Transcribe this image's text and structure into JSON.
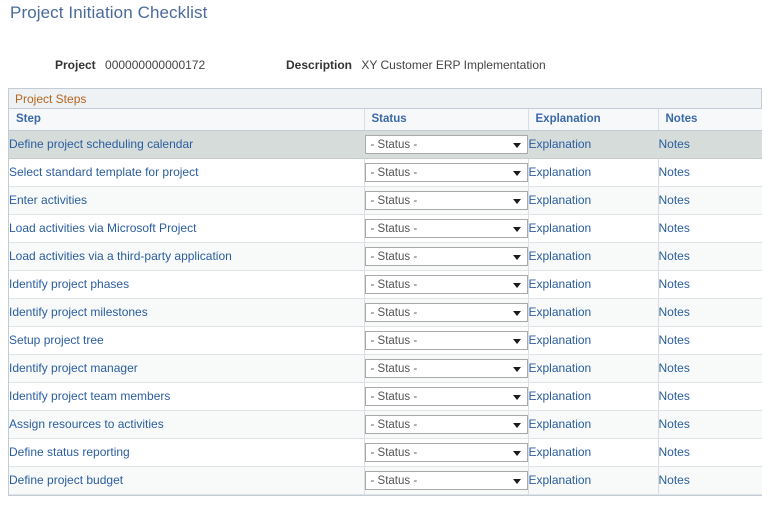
{
  "page": {
    "title": "Project Initiation Checklist"
  },
  "header_fields": {
    "project_label": "Project",
    "project_value": "000000000000172",
    "description_label": "Description",
    "description_value": "XY Customer ERP Implementation"
  },
  "group": {
    "title": "Project Steps"
  },
  "grid": {
    "columns": {
      "step": "Step",
      "status": "Status",
      "explanation": "Explanation",
      "notes": "Notes"
    },
    "status_placeholder": "- Status -",
    "explanation_link": "Explanation",
    "notes_link": "Notes",
    "rows": [
      {
        "step": "Define project scheduling calendar",
        "status": "- Status -",
        "explanation": "Explanation",
        "notes": "Notes",
        "selected": true
      },
      {
        "step": "Select standard template for project",
        "status": "- Status -",
        "explanation": "Explanation",
        "notes": "Notes",
        "selected": false
      },
      {
        "step": "Enter activities",
        "status": "- Status -",
        "explanation": "Explanation",
        "notes": "Notes",
        "selected": false
      },
      {
        "step": "Load activities via Microsoft Project",
        "status": "- Status -",
        "explanation": "Explanation",
        "notes": "Notes",
        "selected": false
      },
      {
        "step": "Load activities via a third-party application",
        "status": "- Status -",
        "explanation": "Explanation",
        "notes": "Notes",
        "selected": false
      },
      {
        "step": "Identify project phases",
        "status": "- Status -",
        "explanation": "Explanation",
        "notes": "Notes",
        "selected": false
      },
      {
        "step": "Identify project milestones",
        "status": "- Status -",
        "explanation": "Explanation",
        "notes": "Notes",
        "selected": false
      },
      {
        "step": "Setup project tree",
        "status": "- Status -",
        "explanation": "Explanation",
        "notes": "Notes",
        "selected": false
      },
      {
        "step": "Identify project manager",
        "status": "- Status -",
        "explanation": "Explanation",
        "notes": "Notes",
        "selected": false
      },
      {
        "step": "Identify project team members",
        "status": "- Status -",
        "explanation": "Explanation",
        "notes": "Notes",
        "selected": false
      },
      {
        "step": "Assign resources to activities",
        "status": "- Status -",
        "explanation": "Explanation",
        "notes": "Notes",
        "selected": false
      },
      {
        "step": "Define status reporting",
        "status": "- Status -",
        "explanation": "Explanation",
        "notes": "Notes",
        "selected": false
      },
      {
        "step": "Define project budget",
        "status": "- Status -",
        "explanation": "Explanation",
        "notes": "Notes",
        "selected": false
      }
    ]
  },
  "colors": {
    "title_blue": "#4a6a9a",
    "link_blue": "#2a5d9f",
    "header_link_blue": "#3a69a8",
    "group_title_orange": "#b5651d",
    "selected_row": "#d5dcda",
    "alt_row": "#f8f9f9",
    "border": "#c3ccd4"
  }
}
